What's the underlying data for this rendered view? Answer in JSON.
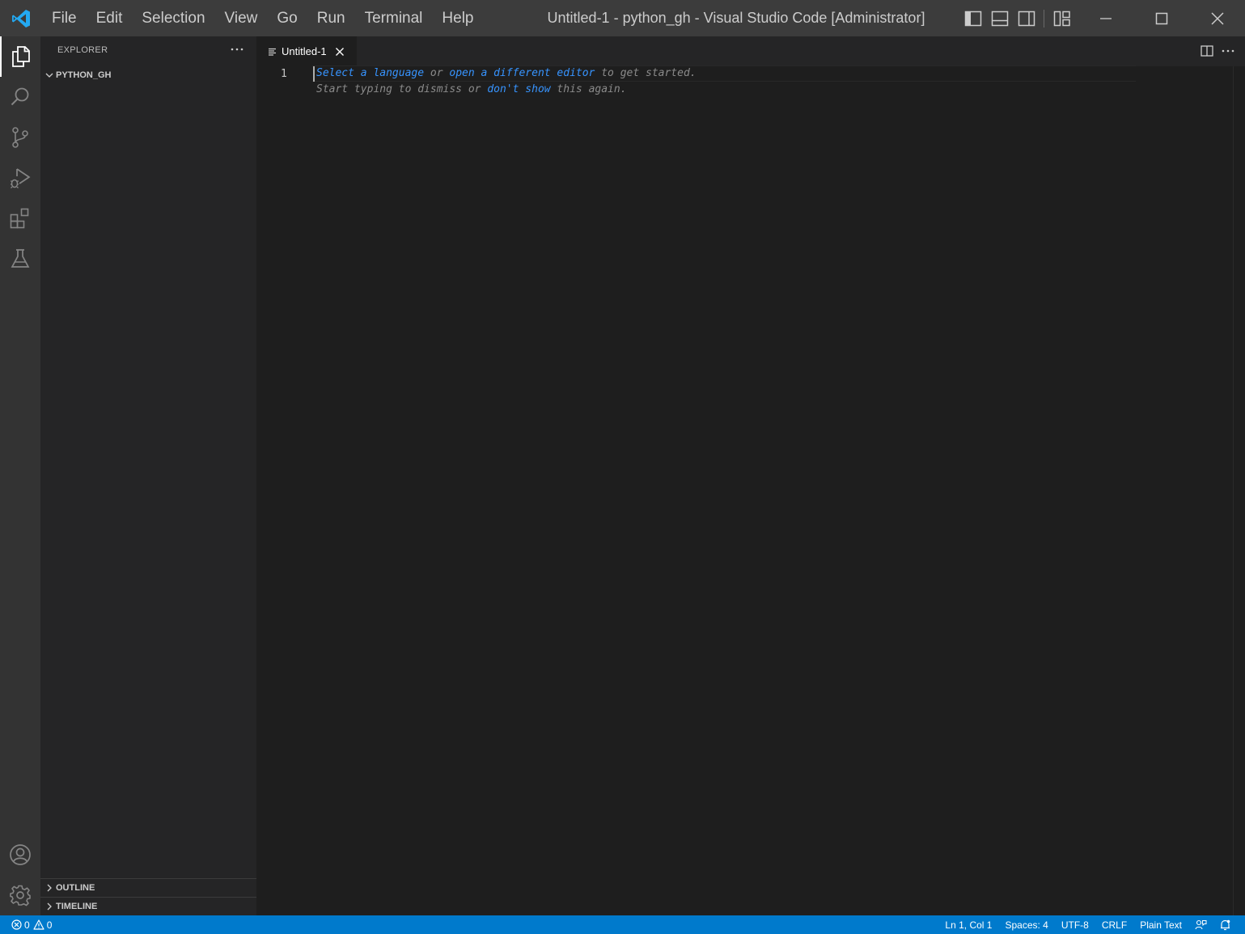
{
  "colors": {
    "titlebar": "#3c3c3c",
    "activitybar": "#333333",
    "sidebar": "#252526",
    "editor": "#1e1e1e",
    "statusbar": "#007acc",
    "accent_logo": "#23a9f2",
    "link": "#3794ff"
  },
  "titlebar": {
    "logo_icon": "vscode-logo-icon",
    "menu": [
      "File",
      "Edit",
      "Selection",
      "View",
      "Go",
      "Run",
      "Terminal",
      "Help"
    ],
    "title": "Untitled-1 - python_gh - Visual Studio Code [Administrator]"
  },
  "activitybar": {
    "items": [
      "files-icon",
      "search-icon",
      "source-control-icon",
      "run-debug-icon",
      "extensions-icon",
      "testing-icon"
    ],
    "bottom_items": [
      "account-icon",
      "settings-gear-icon"
    ],
    "active": "files-icon"
  },
  "sidebar": {
    "title": "EXPLORER",
    "folder": "PYTHON_GH",
    "panels": [
      "OUTLINE",
      "TIMELINE"
    ]
  },
  "editor": {
    "tab": {
      "label": "Untitled-1",
      "icon": "text-lines-icon"
    },
    "line_number": "1",
    "hint_line1": {
      "link1": "Select a language",
      "text1": " or ",
      "link2": "open a different editor",
      "text2": " to get started."
    },
    "hint_line2": {
      "text1": "Start typing to dismiss or ",
      "link": "don't show",
      "text2": " this again."
    }
  },
  "statusbar": {
    "errors": "0",
    "warnings": "0",
    "position": "Ln 1, Col 1",
    "spaces": "Spaces: 4",
    "encoding": "UTF-8",
    "eol": "CRLF",
    "language": "Plain Text"
  }
}
